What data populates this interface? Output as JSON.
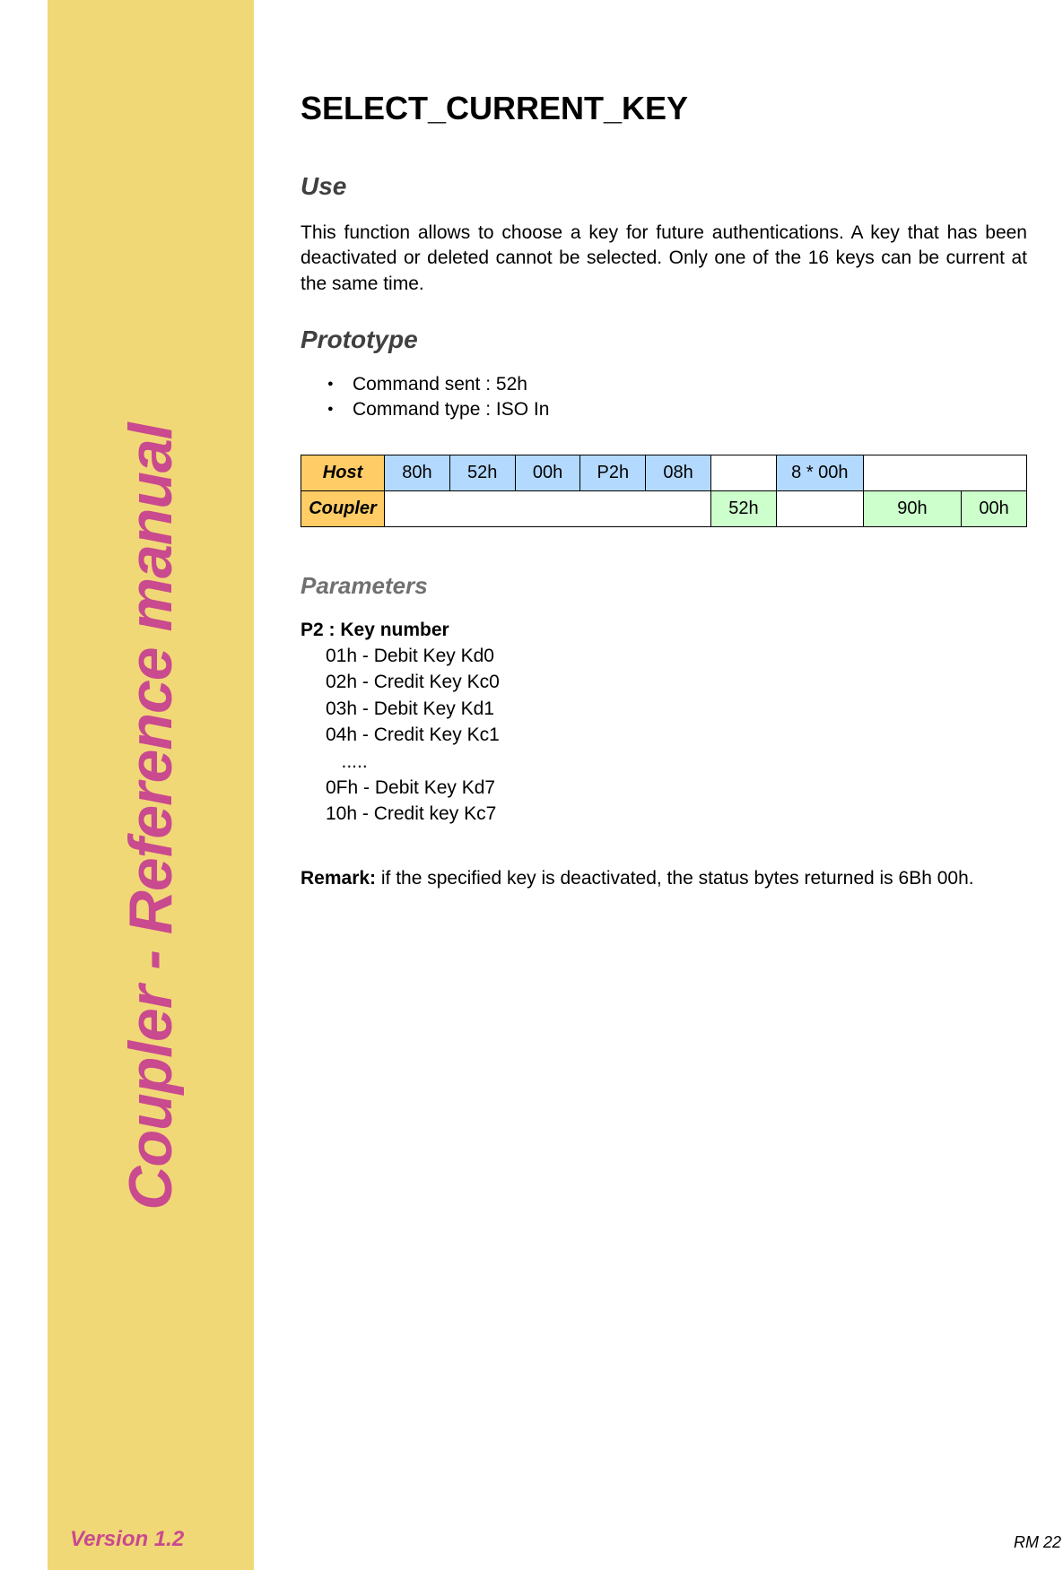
{
  "sidebar": {
    "title": "Coupler - Reference manual",
    "version": "Version 1.2"
  },
  "page_title": "SELECT_CURRENT_KEY",
  "use": {
    "heading": "Use",
    "text": "This function allows to choose a key for future authentications. A key that has been deactivated or deleted cannot be selected. Only one of the 16 keys can be current at the same time."
  },
  "prototype": {
    "heading": "Prototype",
    "bullets": [
      "Command sent : 52h",
      "Command type : ISO In"
    ],
    "table": {
      "host_label": "Host",
      "host_cells": [
        "80h",
        "52h",
        "00h",
        "P2h",
        "08h",
        "",
        "8 * 00h",
        "",
        ""
      ],
      "coupler_label": "Coupler",
      "coupler_cells": [
        "",
        "",
        "",
        "",
        "",
        "52h",
        "",
        "90h",
        "00h"
      ]
    }
  },
  "parameters": {
    "heading": "Parameters",
    "title": "P2 : Key number",
    "lines": [
      "01h - Debit Key Kd0",
      "02h - Credit Key Kc0",
      "03h - Debit Key Kd1",
      "04h - Credit Key Kc1",
      "   .....",
      "0Fh - Debit Key Kd7",
      "10h - Credit key Kc7"
    ]
  },
  "remark": {
    "label": "Remark:",
    "text": " if the specified key is deactivated, the status bytes returned is 6Bh 00h."
  },
  "footer": "RM 22"
}
